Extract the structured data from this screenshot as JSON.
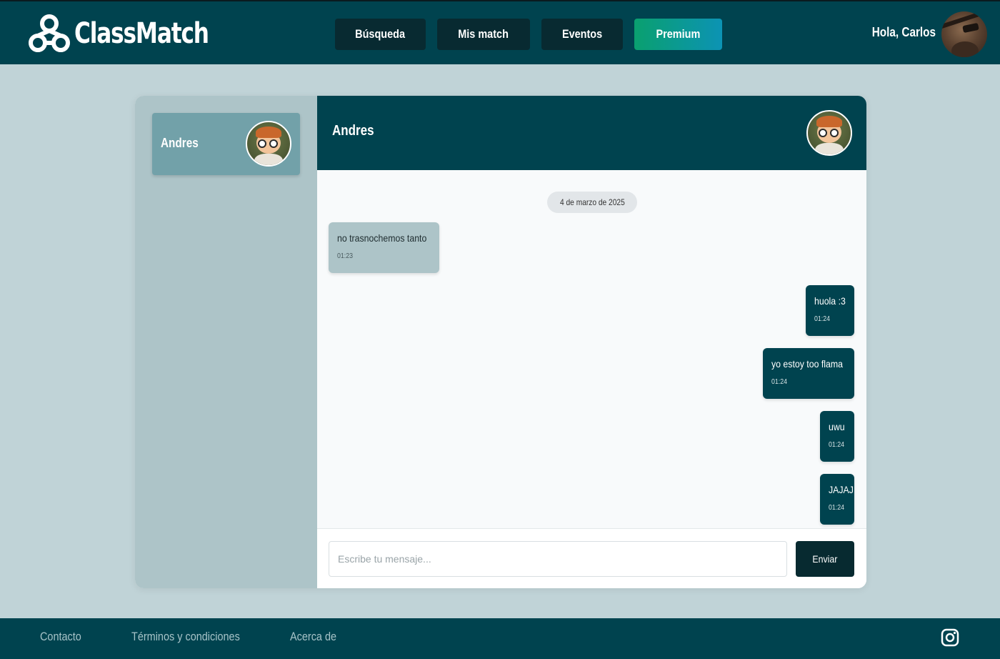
{
  "brand": {
    "name": "ClassMatch",
    "logo_icon": "triple-circle-logo-icon"
  },
  "nav": {
    "search": "Búsqueda",
    "matches": "Mis match",
    "events": "Eventos",
    "premium": "Premium"
  },
  "user": {
    "greeting": "Hola, Carlos",
    "avatar_icon": "user-avatar"
  },
  "sidebar": {
    "contacts": [
      {
        "name": "Andres"
      }
    ]
  },
  "chat": {
    "title": "Andres",
    "date": "4 de marzo de 2025",
    "messages": [
      {
        "direction": "in",
        "text": "no trasnochemos tanto",
        "time": "01:23"
      },
      {
        "direction": "out",
        "text": "huola :3",
        "time": "01:24"
      },
      {
        "direction": "out",
        "text": "yo estoy too flama",
        "time": "01:24"
      },
      {
        "direction": "out",
        "text": "uwu",
        "time": "01:24"
      },
      {
        "direction": "out",
        "text": "JAJAJ",
        "time": "01:24"
      }
    ],
    "input_placeholder": "Escribe tu mensaje...",
    "send_label": "Enviar"
  },
  "footer": {
    "contact": "Contacto",
    "terms": "Términos y condiciones",
    "about": "Acerca de",
    "social_icon": "instagram-icon"
  },
  "colors": {
    "primary": "#00434f",
    "background": "#c0d3d7",
    "sidebar": "#adc4c8",
    "contact_active": "#72a1a9",
    "premium_gradient_start": "#0aa06f",
    "premium_gradient_end": "#0c93b4"
  }
}
